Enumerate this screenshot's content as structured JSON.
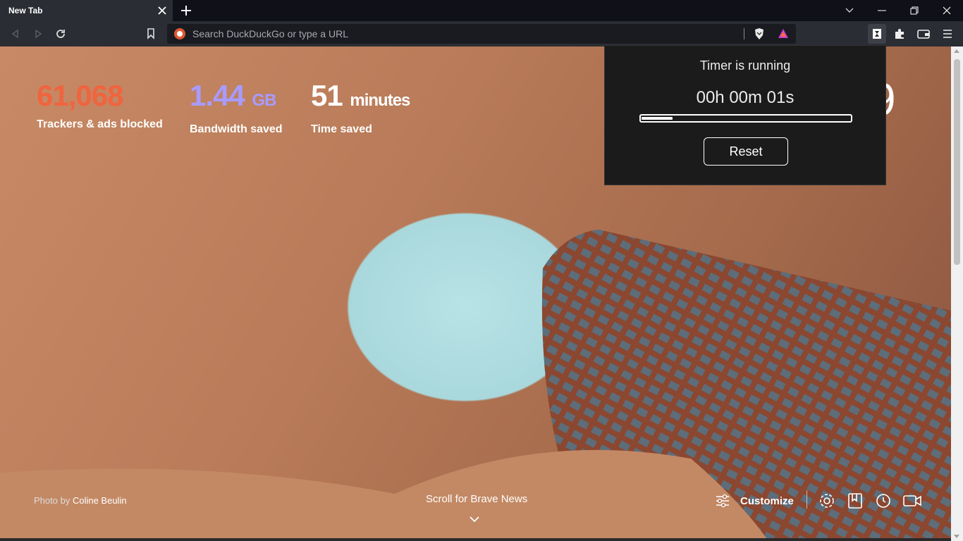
{
  "tab": {
    "title": "New Tab"
  },
  "address": {
    "placeholder": "Search DuckDuckGo or type a URL"
  },
  "stats": {
    "trackers": {
      "value": "61,068",
      "label": "Trackers & ads blocked",
      "color": "#f0643e"
    },
    "bandwidth": {
      "value": "1.44",
      "unit": "GB",
      "label": "Bandwidth saved",
      "color": "#a89bff"
    },
    "time": {
      "value": "51",
      "unit": "minutes",
      "label": "Time saved",
      "color": "#ffffff"
    }
  },
  "clock_partial": "9",
  "photo_credit": {
    "prefix": "Photo by",
    "author": "Coline Beulin"
  },
  "news": {
    "label": "Scroll for Brave News"
  },
  "customize": {
    "label": "Customize"
  },
  "popup": {
    "title": "Timer is running",
    "time": "00h 00m 01s",
    "progress": 0.15,
    "reset_label": "Reset"
  },
  "icons": [
    "back-icon",
    "forward-icon",
    "reload-icon",
    "bookmark-icon",
    "brave-shields-icon",
    "brave-rewards-icon",
    "timer-extension-icon",
    "extensions-icon",
    "wallet-icon",
    "menu-icon",
    "settings-icon",
    "bookmarks-icon",
    "history-icon",
    "brave-talk-icon",
    "customize-icon"
  ]
}
